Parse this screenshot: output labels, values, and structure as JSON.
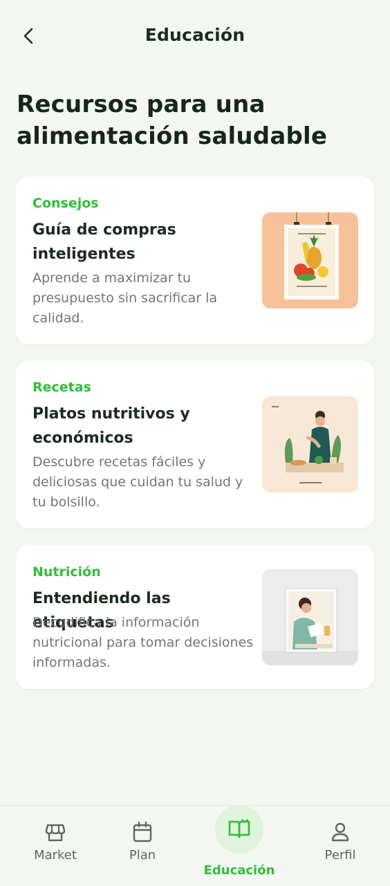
{
  "header": {
    "title": "Educación",
    "back_icon": "chevron-left-icon"
  },
  "page": {
    "heading": "Recursos para una alimentación saludable"
  },
  "cards": [
    {
      "tag": "Consejos",
      "title": "Guía de compras inteligentes",
      "description": "Aprende a maximizar tu presupuesto sin sacrificar la calidad.",
      "image": "grocery-poster-illustration"
    },
    {
      "tag": "Recetas",
      "title": "Platos nutritivos y económicos",
      "description": "Descubre recetas fáciles y deliciosas que cuidan tu salud y tu bolsillo.",
      "image": "woman-cooking-illustration"
    },
    {
      "tag": "Nutrición",
      "title": "Entendiendo las etiquetas",
      "description": "Decodifica la información nutricional para tomar decisiones informadas.",
      "image": "woman-reading-label-illustration"
    }
  ],
  "nav": {
    "items": [
      {
        "label": "Market",
        "icon": "store-icon",
        "active": false
      },
      {
        "label": "Plan",
        "icon": "calendar-icon",
        "active": false
      },
      {
        "label": "Educación",
        "icon": "book-open-icon",
        "active": true
      },
      {
        "label": "Perfil",
        "icon": "user-icon",
        "active": false
      }
    ]
  },
  "colors": {
    "background": "#f4f6f2",
    "accent": "#2fbd38",
    "active_nav_bg": "#dff3dd"
  }
}
